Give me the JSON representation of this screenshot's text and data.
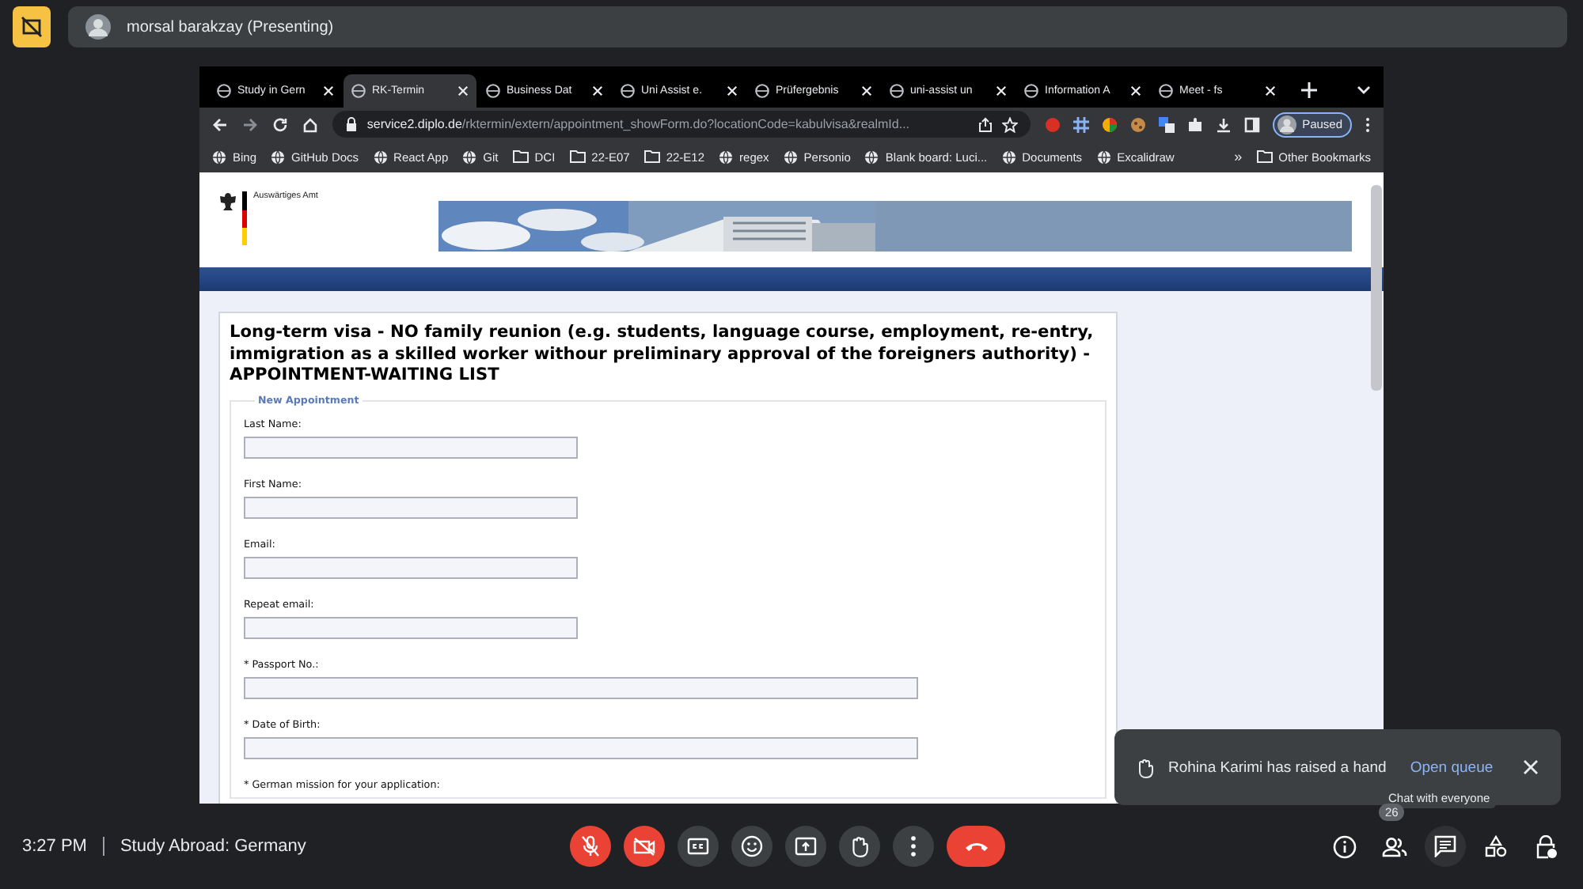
{
  "meet_top": {
    "presenter": "morsal barakzay (Presenting)"
  },
  "browser": {
    "tabs": [
      {
        "label": "Study in Gern",
        "selected": false
      },
      {
        "label": "RK-Termin",
        "selected": true
      },
      {
        "label": "Business Dat",
        "selected": false
      },
      {
        "label": "Uni Assist e.",
        "selected": false
      },
      {
        "label": "Prüfergebnis",
        "selected": false
      },
      {
        "label": "uni-assist un",
        "selected": false
      },
      {
        "label": "Information A",
        "selected": false
      },
      {
        "label": "Meet - fs",
        "selected": false
      }
    ],
    "url_host": "service2.diplo.de",
    "url_path": "/rktermin/extern/appointment_showForm.do?locationCode=kabulvisa&realmId...",
    "profile_status": "Paused",
    "bookmarks": [
      {
        "label": "Bing",
        "kind": "link"
      },
      {
        "label": "GitHub Docs",
        "kind": "link"
      },
      {
        "label": "React App",
        "kind": "link"
      },
      {
        "label": "Git",
        "kind": "link"
      },
      {
        "label": "DCI",
        "kind": "folder"
      },
      {
        "label": "22-E07",
        "kind": "folder"
      },
      {
        "label": "22-E12",
        "kind": "folder"
      },
      {
        "label": "regex",
        "kind": "link"
      },
      {
        "label": "Personio",
        "kind": "link"
      },
      {
        "label": "Blank board: Luci...",
        "kind": "link"
      },
      {
        "label": "Documents",
        "kind": "link"
      },
      {
        "label": "Excalidraw",
        "kind": "link"
      }
    ],
    "more_bookmarks": "»",
    "other_bookmarks": "Other Bookmarks"
  },
  "page": {
    "agency": "Auswärtiges Amt",
    "heading": "Long-term visa - NO family reunion (e.g. students, language course, employment, re-entry, immigration as a skilled worker withour preliminary approval of the foreigners authority) - APPOINTMENT-WAITING LIST",
    "legend": "New Appointment",
    "fields": [
      {
        "label": "Last Name:",
        "kind": "short"
      },
      {
        "label": "First Name:",
        "kind": "short"
      },
      {
        "label": "Email:",
        "kind": "short"
      },
      {
        "label": "Repeat email:",
        "kind": "short"
      },
      {
        "label": "* Passport No.:",
        "kind": "long"
      },
      {
        "label": "* Date of Birth:",
        "kind": "long"
      },
      {
        "label": "* German mission for your application:",
        "kind": "label"
      }
    ]
  },
  "notification": {
    "text": "Rohina Karimi has raised a hand",
    "action": "Open queue"
  },
  "tooltip": "Chat with everyone",
  "meeting": {
    "time": "3:27 PM",
    "title": "Study Abroad: Germany"
  },
  "controls": [
    {
      "kind": "mic",
      "on": false
    },
    {
      "kind": "camera",
      "on": false
    },
    {
      "kind": "captions"
    },
    {
      "kind": "emoji"
    },
    {
      "kind": "present"
    },
    {
      "kind": "hand"
    },
    {
      "kind": "more"
    },
    {
      "kind": "leave"
    }
  ],
  "side_controls": [
    {
      "kind": "info",
      "selected": false
    },
    {
      "kind": "people",
      "selected": false,
      "badge": "26"
    },
    {
      "kind": "chat",
      "selected": true
    },
    {
      "kind": "activities",
      "selected": false
    },
    {
      "kind": "host",
      "selected": false
    }
  ]
}
